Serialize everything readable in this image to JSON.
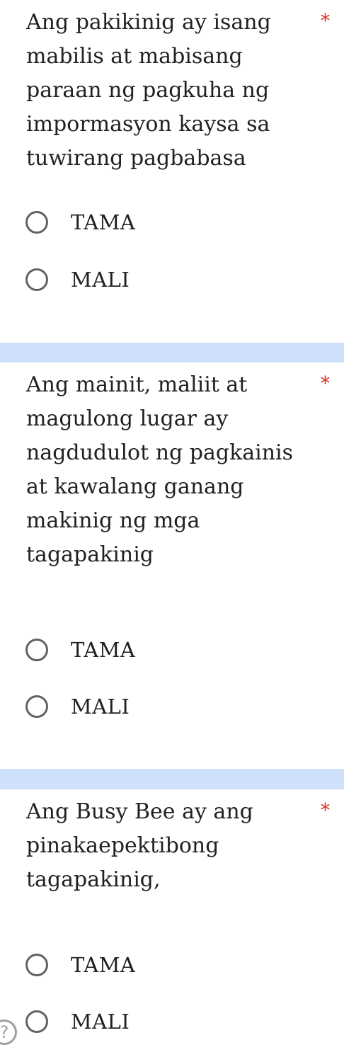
{
  "questions": [
    {
      "text": "Ang pakikinig ay isang mabilis at mabisang paraan ng pagkuha ng impormasyon kaysa sa tuwirang pagbabasa",
      "required_mark": "*",
      "options": [
        "TAMA",
        "MALI"
      ]
    },
    {
      "text": "Ang mainit, maliit at magulong lugar ay nagdudulot ng pagkainis at kawalang ganang makinig ng mga tagapakinig",
      "required_mark": "*",
      "options": [
        "TAMA",
        "MALI"
      ]
    },
    {
      "text": "Ang Busy Bee ay ang pinakaepektibong tagapakinig,",
      "required_mark": "*",
      "options": [
        "TAMA",
        "MALI"
      ]
    }
  ],
  "help_button": {
    "icon": "question-mark-icon",
    "glyph": "?"
  },
  "colors": {
    "background": "#cfe0fa",
    "card": "#ffffff",
    "required": "#d93025",
    "radio_border": "#5f6368"
  }
}
